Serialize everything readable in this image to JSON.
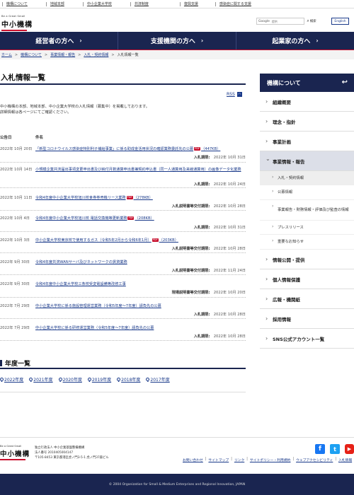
{
  "toplinks": [
    "機構について",
    "地域本部",
    "中小企業大学校",
    "共済制度",
    "復興支援",
    "感染症に関する支援"
  ],
  "header": {
    "logo_tag": "Be a Great Small",
    "logo_name": "中小機構",
    "search_brand": "Google",
    "search_placeholder": "提供",
    "search_button": "検索",
    "english": "English"
  },
  "gnav": [
    "経営者の方へ",
    "支援機関の方へ",
    "起業家の方へ"
  ],
  "breadcrumb": {
    "links": [
      "ホーム",
      "機構について",
      "事業情報・報告",
      "入札・契約情報"
    ],
    "current": "入札情報一覧"
  },
  "page": {
    "title": "入札情報一覧",
    "rss": "RSS",
    "intro_line1": "中小機構の本部、地域本部、中小企業大学校の入札情報（募集中）を掲載しております。",
    "intro_line2": "詳細情報は各ページにてご確認ください。",
    "col_date": "公告日",
    "col_name": "件名"
  },
  "rows": [
    {
      "date": "2022年 10月 20日",
      "title": "「新型コロナウイルス感染症特別利子補給事業」に係る助成金活用状況の確認業務委託先の公募",
      "pdf": "PDF",
      "size": "（447KB）",
      "dl_label": "入札期限:",
      "dl": "2022年 10月 31日"
    },
    {
      "date": "2022年 10月 14日",
      "title": "小規模企業共済届出事項変更申出書及び納付月数通算申出書兼契約申込書（同一人通算用及来線通算用）の画像データ化業務",
      "pdf": "",
      "size": "",
      "dl_label": "入札期限:",
      "dl": "2022年 10月 24日"
    },
    {
      "date": "2022年 10月 11日",
      "title": "令和4年度中小企業大学校旭川校食券券売機リース業務",
      "pdf": "PDF",
      "size": "（278KB）",
      "dl_label": "入札説明書等交付期限:",
      "dl": "2022年 10月 28日"
    },
    {
      "date": "2022年 10月 4日",
      "title": "令和4年度中小企業大学校旭川校 電話交換機等更新業務",
      "pdf": "PDF",
      "size": "（208KB）",
      "dl_label": "入札期限:",
      "dl": "2022年 10月 31日"
    },
    {
      "date": "2022年 10月 3日",
      "title": "中小企業大学校東京校で使用するガス（令和5年2月から令和6年1月）",
      "pdf": "PDF",
      "size": "（203KB）",
      "dl_label": "入札説明書等交付期限:",
      "dl": "2022年 10月 28日"
    },
    {
      "date": "2022年 9月 30日",
      "title": "令和4年度共済WANサーバ及びネットワークの賃貸業務",
      "pdf": "",
      "size": "",
      "dl_label": "入札説明書等交付期限:",
      "dl": "2022年 11月 24日"
    },
    {
      "date": "2022年 9月 30日",
      "title": "令和4年度中小企業大学校三条校受変電設備等改修工事",
      "pdf": "",
      "size": "",
      "dl_label": "現場説明書等交付期限:",
      "dl": "2022年 10月 20日"
    },
    {
      "date": "2022年 7月 29日",
      "title": "中小企業大学校に係る施設管理運営業務（令和5年度〜7年度）請負先の公募",
      "pdf": "",
      "size": "",
      "dl_label": "入札期限:",
      "dl": "2022年 10月 28日"
    },
    {
      "date": "2022年 7月 29日",
      "title": "中小企業大学校に係る研修運営業務（令和5年度〜7年度）請負先の公募",
      "pdf": "",
      "size": "",
      "dl_label": "入札期限:",
      "dl": "2022年 10月 28日"
    }
  ],
  "years": {
    "title": "年度一覧",
    "items": [
      "2022年度",
      "2021年度",
      "2020年度",
      "2019年度",
      "2018年度",
      "2017年度"
    ]
  },
  "sidebar": {
    "header": "機構について",
    "items": [
      "組織概要",
      "理念・指針",
      "事業計画",
      "事業情報・報告"
    ],
    "subitems": [
      "入札・契約情報",
      "公募情報",
      "事業報告・財務情報・評価及び監査の情報",
      "プレスリリース",
      "重要なお知らせ"
    ],
    "items2": [
      "情報公開・提供",
      "個人情報保護",
      "広報・機関紙",
      "採用情報",
      "SNS公式アカウント一覧"
    ]
  },
  "footer": {
    "tag": "Be a Great Small",
    "name": "中小機構",
    "addr1": "独立行政法人 中小企業基盤整備機構",
    "addr2": "法人番号 2010405004147",
    "addr3": "〒105-8453 東京都港区虎ノ門3-5-1 虎ノ門37森ビル",
    "links": [
      "お問い合わせ",
      "サイトマップ",
      "リンク",
      "サイトポリシー・利用規約",
      "ウェブアクセシビリティ",
      "入札情報"
    ],
    "copyright": "© 2004 Organization for Small & Medium Enterprises and Regional Innovation, JAPAN"
  },
  "colors": {
    "navy": "#1a2550",
    "accent_red": "#c8102e",
    "link": "#1a3a8a"
  }
}
